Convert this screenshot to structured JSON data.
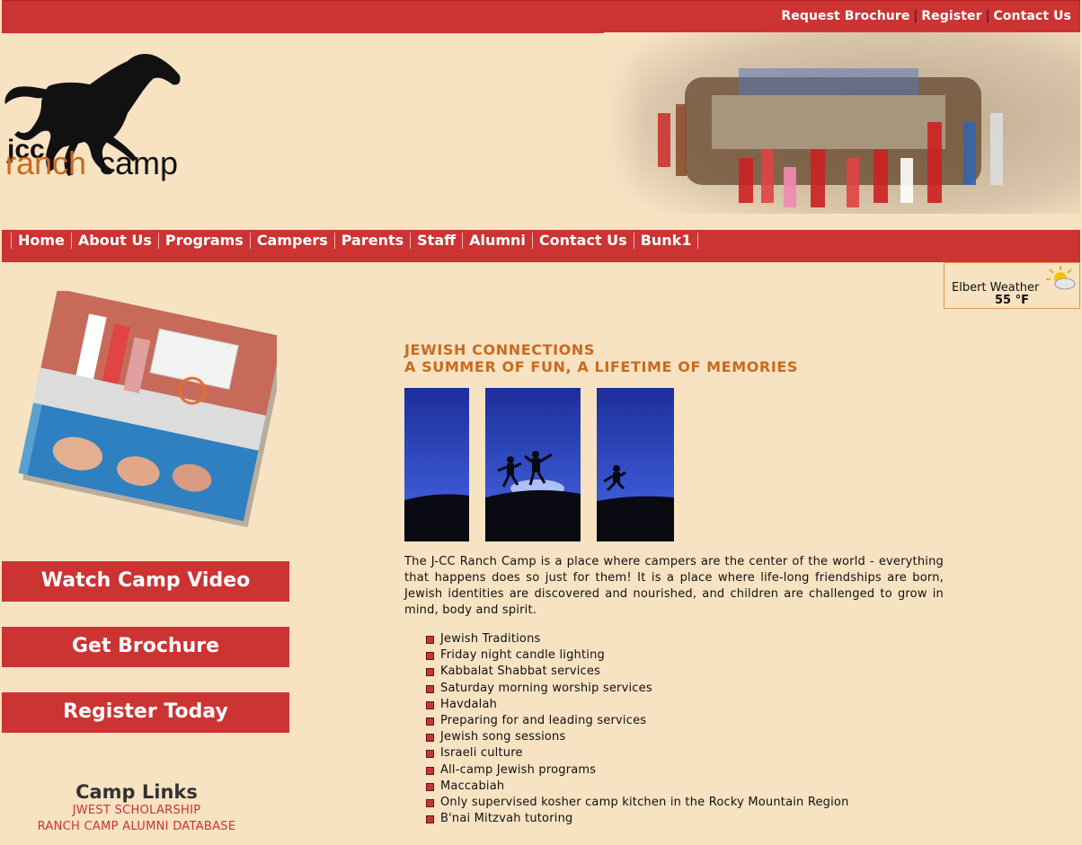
{
  "top_links": [
    "Request Brochure",
    "Register",
    "Contact Us"
  ],
  "logo": {
    "text_jcc": "jcc",
    "text_ranch": "ranch",
    "text_camp": "camp"
  },
  "nav": [
    "Home",
    "About Us",
    "Programs",
    "Campers",
    "Parents",
    "Staff",
    "Alumni",
    "Contact Us",
    "Bunk1"
  ],
  "weather": {
    "location": "Elbert Weather",
    "temp": "55 °F"
  },
  "cta": [
    "Watch Camp Video",
    "Get Brochure",
    "Register Today"
  ],
  "camp_links": {
    "title": "Camp Links",
    "items": [
      "JWEST SCHOLARSHIP",
      "RANCH CAMP ALUMNI DATABASE"
    ]
  },
  "headline": {
    "line1": "JEWISH CONNECTIONS",
    "line2": "A SUMMER OF FUN, A LIFETIME OF MEMORIES"
  },
  "intro": "The J-CC Ranch Camp is a place where campers are the center of the world - everything that happens does so just for them! It is a place where life-long friendships are born, Jewish identities are discovered and nourished, and children are challenged to grow in mind, body and spirit.",
  "bullets": [
    "Jewish Traditions",
    "Friday night candle lighting",
    "Kabbalat Shabbat services",
    "Saturday morning worship services",
    "Havdalah",
    "Preparing for and leading services",
    "Jewish song sessions",
    "Israeli culture",
    "All-camp Jewish programs",
    "Maccabiah",
    "Only supervised kosher camp kitchen in the Rocky Mountain Region",
    "B'nai Mitzvah tutoring"
  ],
  "colors": {
    "brand_red": "#cc3333",
    "background": "#f7e2c2",
    "accent_orange": "#c96a1f"
  }
}
